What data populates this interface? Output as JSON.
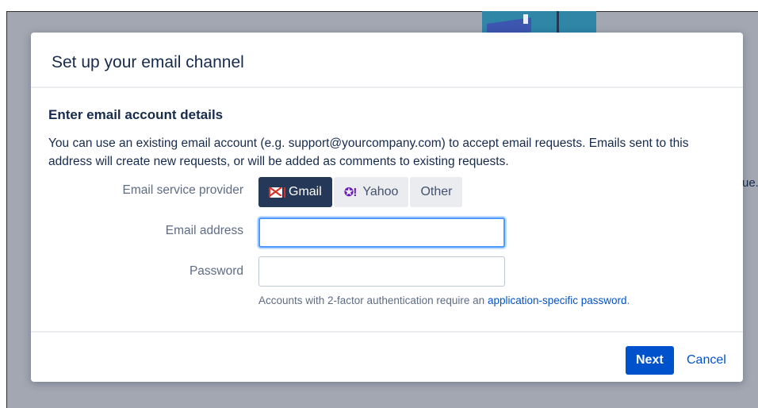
{
  "background": {
    "partial_text": "ue."
  },
  "dialog": {
    "title": "Set up your email channel",
    "section_title": "Enter email account details",
    "description": "You can use an existing email account (e.g. support@yourcompany.com) to accept email requests. Emails sent to this address will create new requests, or will be added as comments to existing requests."
  },
  "form": {
    "provider_label": "Email service provider",
    "providers": [
      {
        "label": "Gmail",
        "icon": "gmail-icon",
        "selected": true
      },
      {
        "label": "Yahoo",
        "icon": "yahoo-icon",
        "selected": false
      },
      {
        "label": "Other",
        "icon": "",
        "selected": false
      }
    ],
    "yahoo_icon_glyph": "✪!",
    "email_label": "Email address",
    "email_value": "",
    "password_label": "Password",
    "password_value": "",
    "help_text": "Accounts with 2-factor authentication require an",
    "help_link": "application-specific password",
    "help_suffix": "."
  },
  "footer": {
    "next_label": "Next",
    "cancel_label": "Cancel"
  },
  "colors": {
    "primary": "#0052cc",
    "selected_toggle": "#253858",
    "focus_ring": "#4c9aff",
    "backdrop": "#a2a7b1"
  }
}
